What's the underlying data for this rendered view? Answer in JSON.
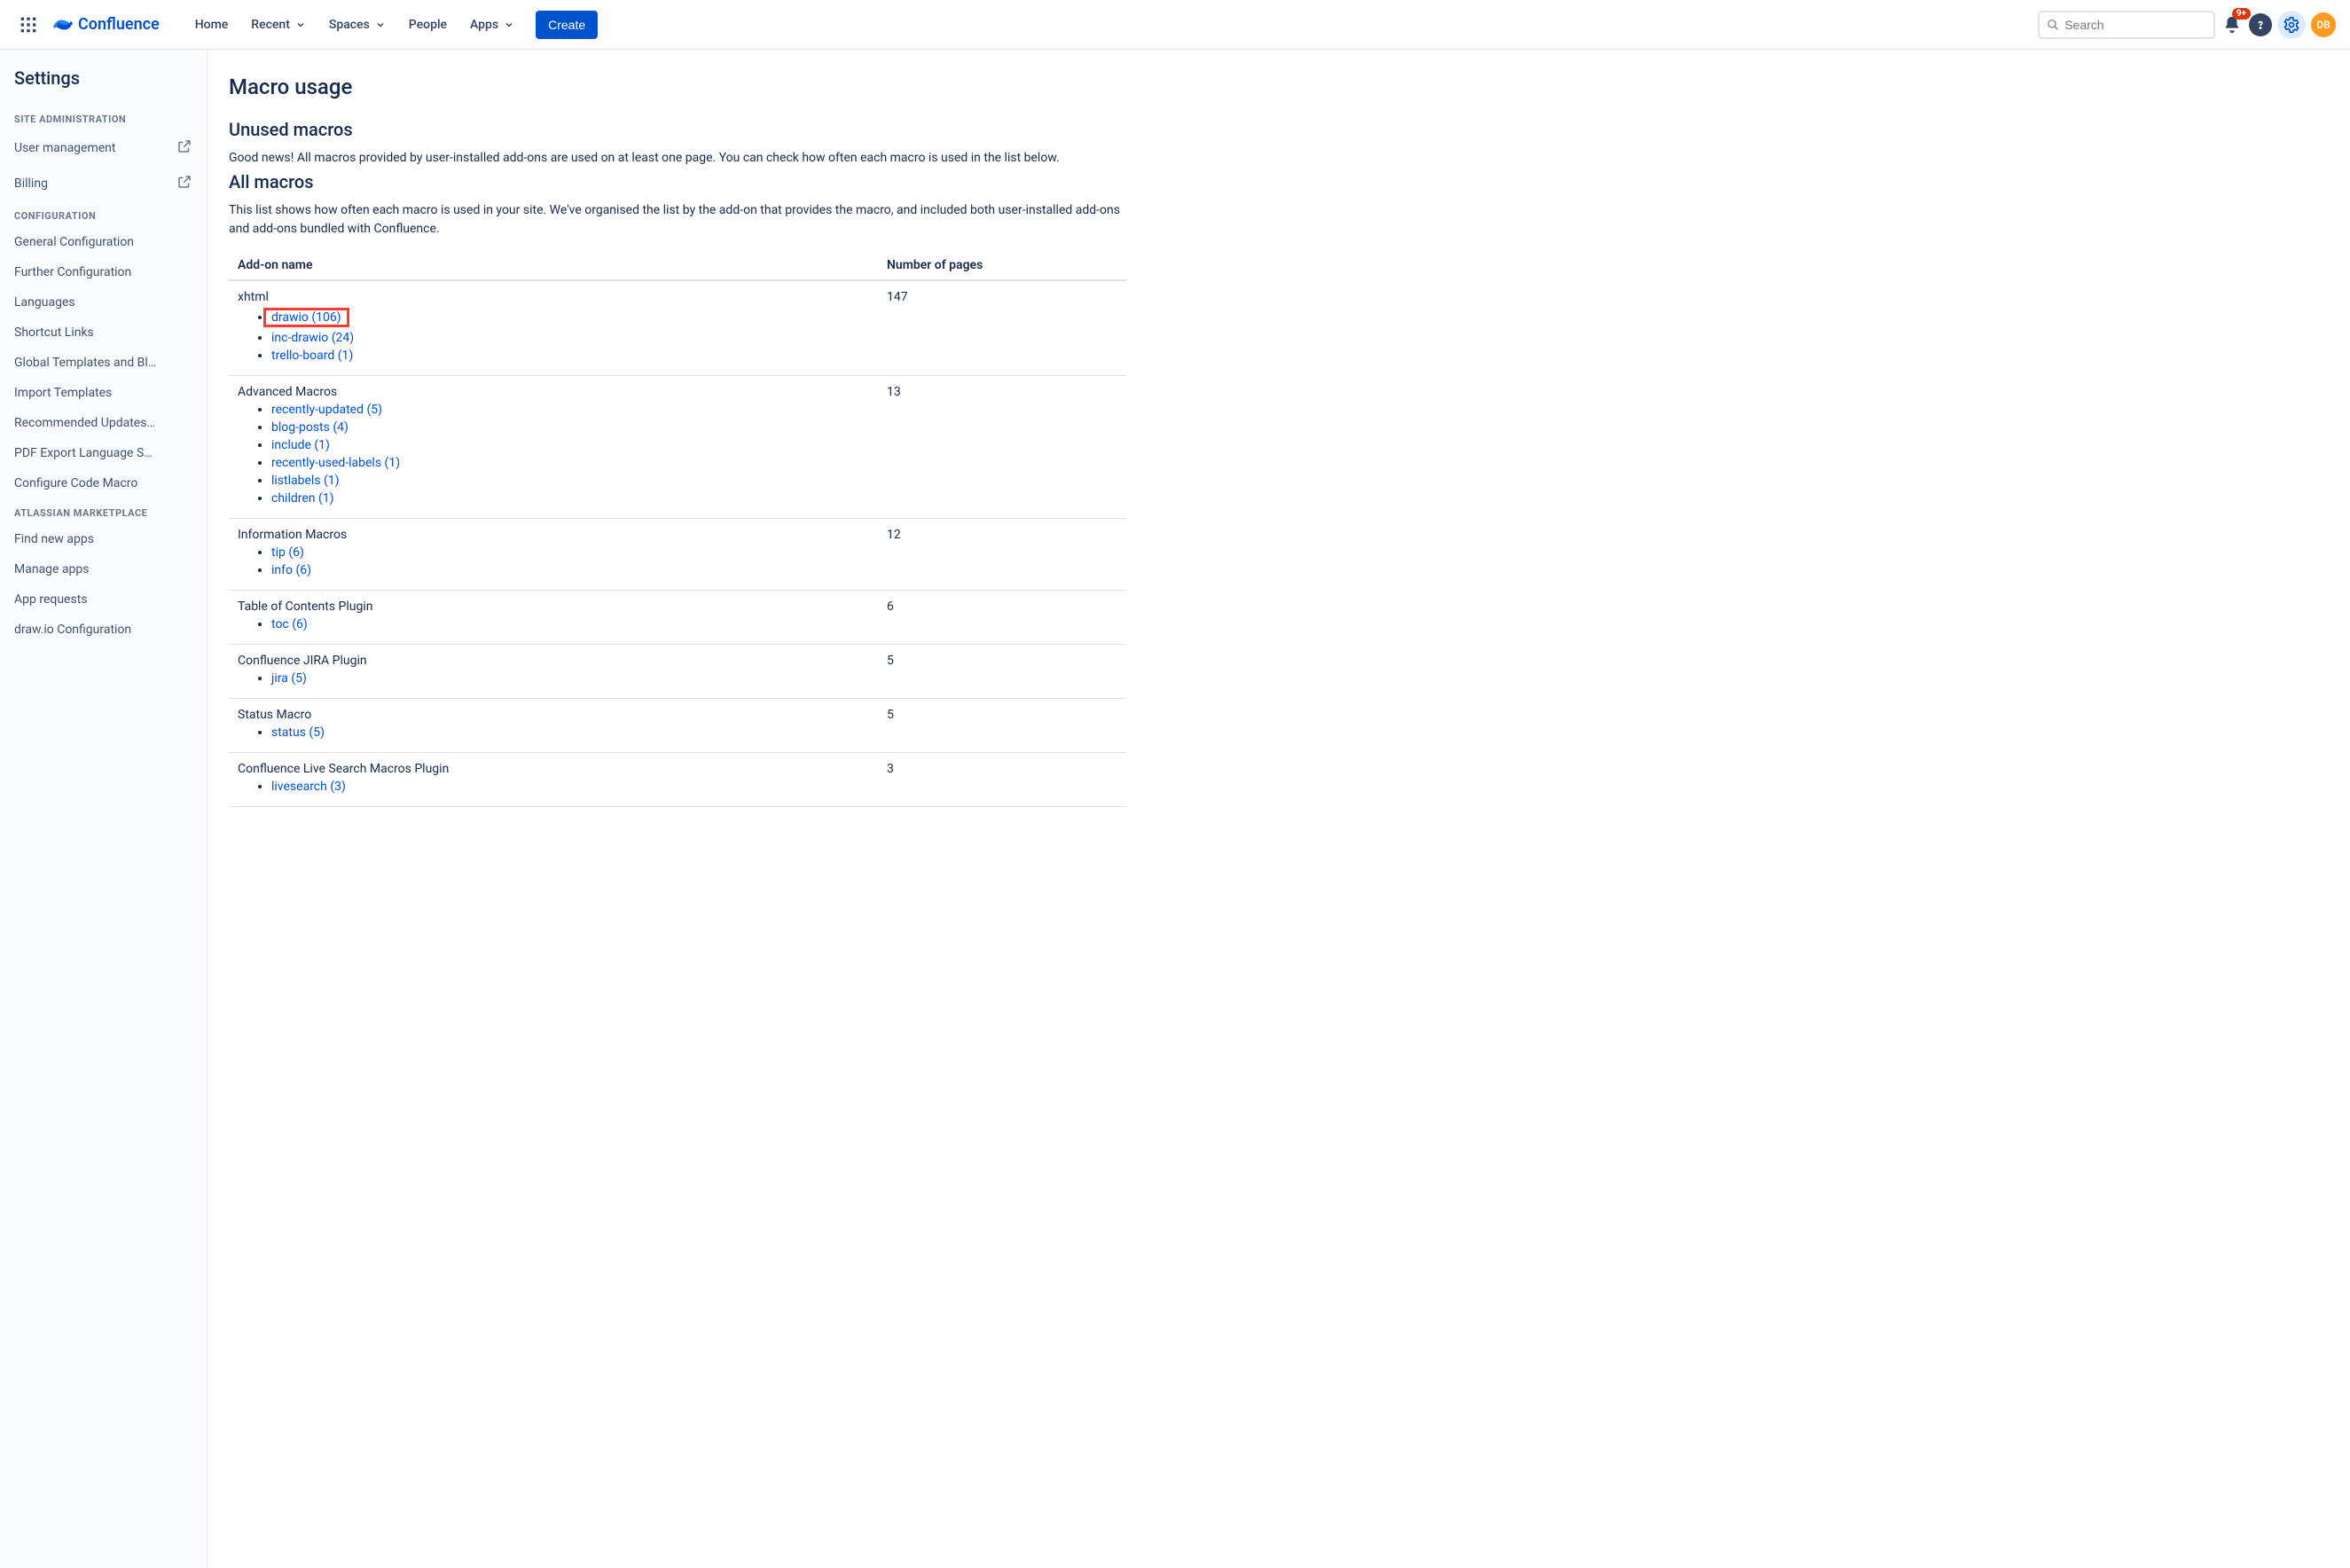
{
  "topnav": {
    "product": "Confluence",
    "links": {
      "home": "Home",
      "recent": "Recent",
      "spaces": "Spaces",
      "people": "People",
      "apps": "Apps"
    },
    "create": "Create",
    "search_placeholder": "Search",
    "notification_badge": "9+",
    "avatar_initials": "DB"
  },
  "sidebar": {
    "title": "Settings",
    "sections": [
      {
        "heading": "SITE ADMINISTRATION",
        "items": [
          {
            "label": "User management",
            "external": true
          },
          {
            "label": "Billing",
            "external": true
          }
        ]
      },
      {
        "heading": "CONFIGURATION",
        "items": [
          {
            "label": "General Configuration"
          },
          {
            "label": "Further Configuration"
          },
          {
            "label": "Languages"
          },
          {
            "label": "Shortcut Links"
          },
          {
            "label": "Global Templates and Bl…"
          },
          {
            "label": "Import Templates"
          },
          {
            "label": "Recommended Updates…"
          },
          {
            "label": "PDF Export Language S…"
          },
          {
            "label": "Configure Code Macro"
          }
        ]
      },
      {
        "heading": "ATLASSIAN MARKETPLACE",
        "items": [
          {
            "label": "Find new apps"
          },
          {
            "label": "Manage apps"
          },
          {
            "label": "App requests"
          },
          {
            "label": "draw.io Configuration"
          }
        ]
      }
    ]
  },
  "content": {
    "title": "Macro usage",
    "unused_heading": "Unused macros",
    "unused_text": "Good news! All macros provided by user-installed add-ons are used on at least one page. You can check how often each macro is used in the list below.",
    "all_heading": "All macros",
    "all_text": "This list shows how often each macro is used in your site. We've organised the list by the add-on that provides the macro, and included both user-installed add-ons and add-ons bundled with Confluence.",
    "table": {
      "col_addon": "Add-on name",
      "col_pages": "Number of pages",
      "rows": [
        {
          "addon": "xhtml",
          "pages": "147",
          "macros": [
            {
              "label": "drawio (106)",
              "highlight": true
            },
            {
              "label": "inc-drawio (24)"
            },
            {
              "label": "trello-board (1)"
            }
          ]
        },
        {
          "addon": "Advanced Macros",
          "pages": "13",
          "macros": [
            {
              "label": "recently-updated (5)"
            },
            {
              "label": "blog-posts (4)"
            },
            {
              "label": "include (1)"
            },
            {
              "label": "recently-used-labels (1)"
            },
            {
              "label": "listlabels (1)"
            },
            {
              "label": "children (1)"
            }
          ]
        },
        {
          "addon": "Information Macros",
          "pages": "12",
          "macros": [
            {
              "label": "tip (6)"
            },
            {
              "label": "info (6)"
            }
          ]
        },
        {
          "addon": "Table of Contents Plugin",
          "pages": "6",
          "macros": [
            {
              "label": "toc (6)"
            }
          ]
        },
        {
          "addon": "Confluence JIRA Plugin",
          "pages": "5",
          "macros": [
            {
              "label": "jira (5)"
            }
          ]
        },
        {
          "addon": "Status Macro",
          "pages": "5",
          "macros": [
            {
              "label": "status (5)"
            }
          ]
        },
        {
          "addon": "Confluence Live Search Macros Plugin",
          "pages": "3",
          "macros": [
            {
              "label": "livesearch (3)"
            }
          ]
        }
      ]
    }
  }
}
